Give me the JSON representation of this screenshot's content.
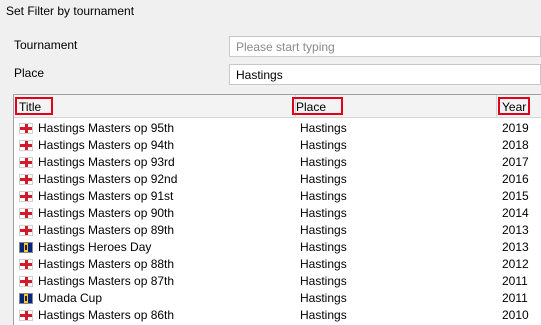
{
  "dialog": {
    "title": "Set Filter by tournament"
  },
  "filters": {
    "tournament_label": "Tournament",
    "tournament_placeholder": "Please start typing",
    "tournament_value": "",
    "place_label": "Place",
    "place_value": "Hastings"
  },
  "grid": {
    "columns": {
      "title": "Title",
      "place": "Place",
      "year": "Year"
    },
    "rows": [
      {
        "flag": "england-flag-icon",
        "title": "Hastings Masters op 95th",
        "place": "Hastings",
        "year": "2019"
      },
      {
        "flag": "england-flag-icon",
        "title": "Hastings Masters op 94th",
        "place": "Hastings",
        "year": "2018"
      },
      {
        "flag": "england-flag-icon",
        "title": "Hastings Masters op 93rd",
        "place": "Hastings",
        "year": "2017"
      },
      {
        "flag": "england-flag-icon",
        "title": "Hastings Masters op 92nd",
        "place": "Hastings",
        "year": "2016"
      },
      {
        "flag": "england-flag-icon",
        "title": "Hastings Masters op 91st",
        "place": "Hastings",
        "year": "2015"
      },
      {
        "flag": "england-flag-icon",
        "title": "Hastings Masters op 90th",
        "place": "Hastings",
        "year": "2014"
      },
      {
        "flag": "england-flag-icon",
        "title": "Hastings Masters op 89th",
        "place": "Hastings",
        "year": "2013"
      },
      {
        "flag": "barbados-flag-icon",
        "title": "Hastings Heroes Day",
        "place": "Hastings",
        "year": "2013"
      },
      {
        "flag": "england-flag-icon",
        "title": "Hastings Masters op 88th",
        "place": "Hastings",
        "year": "2012"
      },
      {
        "flag": "england-flag-icon",
        "title": "Hastings Masters op 87th",
        "place": "Hastings",
        "year": "2011"
      },
      {
        "flag": "barbados-flag-icon",
        "title": "Umada Cup",
        "place": "Hastings",
        "year": "2011"
      },
      {
        "flag": "england-flag-icon",
        "title": "Hastings Masters op 86th",
        "place": "Hastings",
        "year": "2010"
      }
    ]
  }
}
